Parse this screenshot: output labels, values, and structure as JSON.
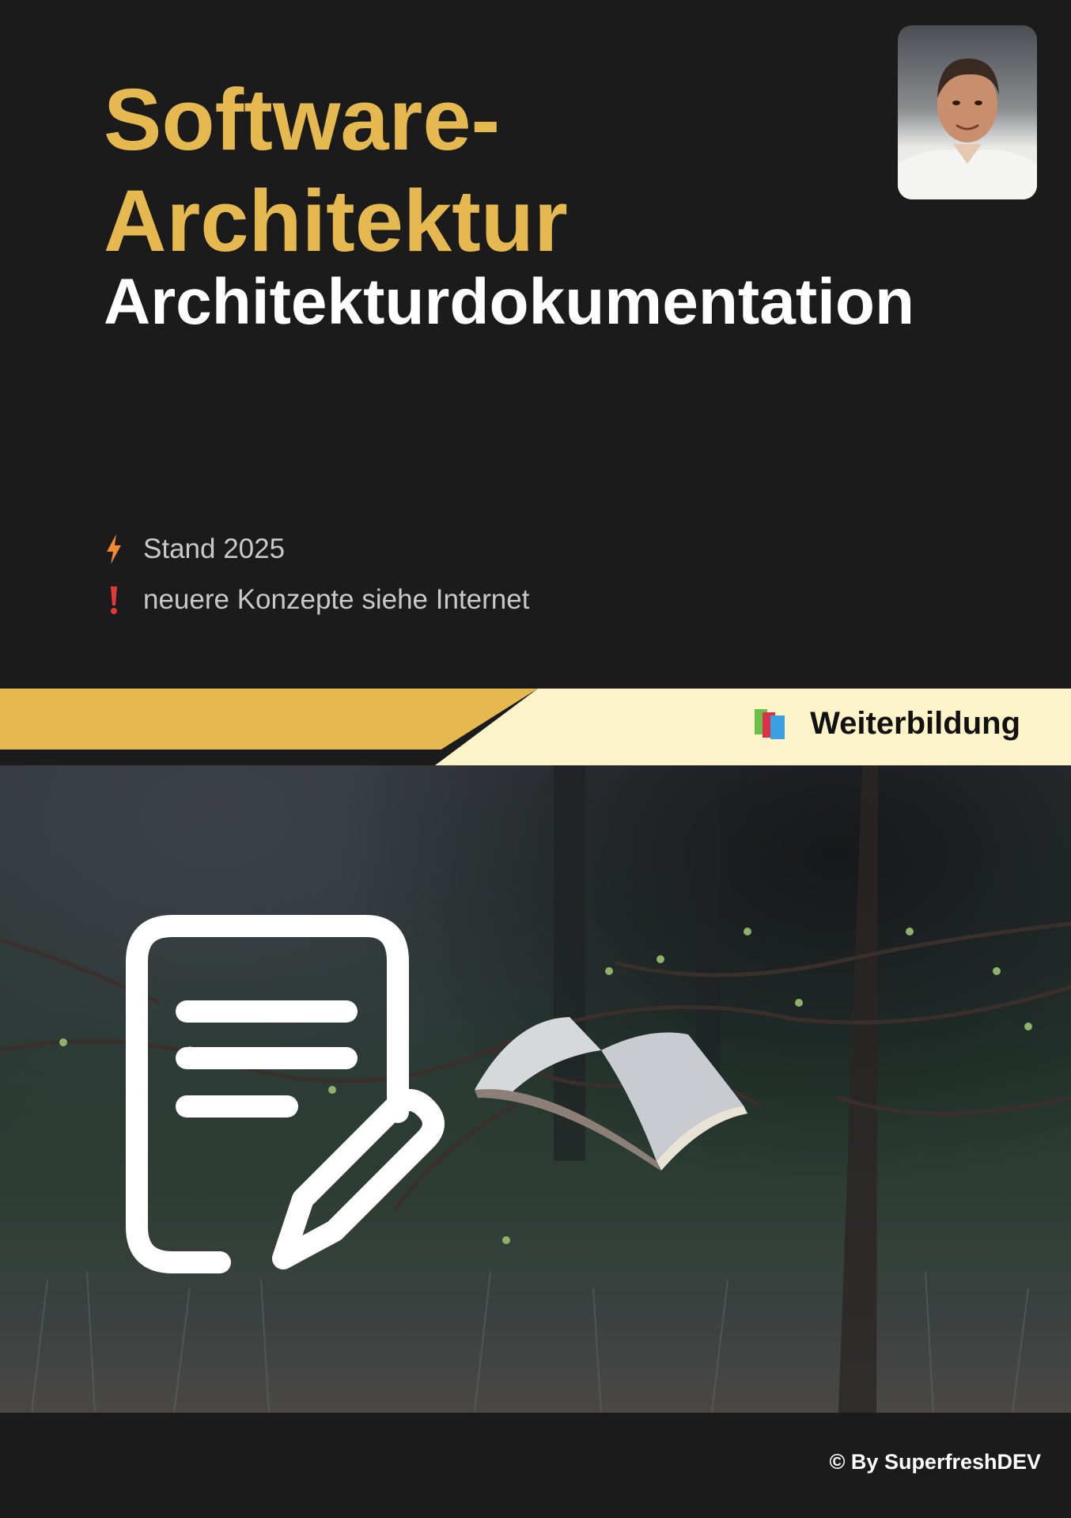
{
  "header": {
    "title": "Software-\nArchitektur",
    "subtitle": "Architekturdokumentation"
  },
  "notes": [
    {
      "icon": "lightning-icon",
      "text": "Stand 2025"
    },
    {
      "icon": "exclamation-icon",
      "text": "neuere Konzepte siehe Internet"
    }
  ],
  "badge": {
    "icon": "books-icon",
    "label": "Weiterbildung"
  },
  "footer": {
    "copyright": "© By SuperfreshDEV"
  },
  "colors": {
    "accent": "#e5b94f",
    "background": "#1b1b1c",
    "band_light": "#fdf3c8"
  }
}
